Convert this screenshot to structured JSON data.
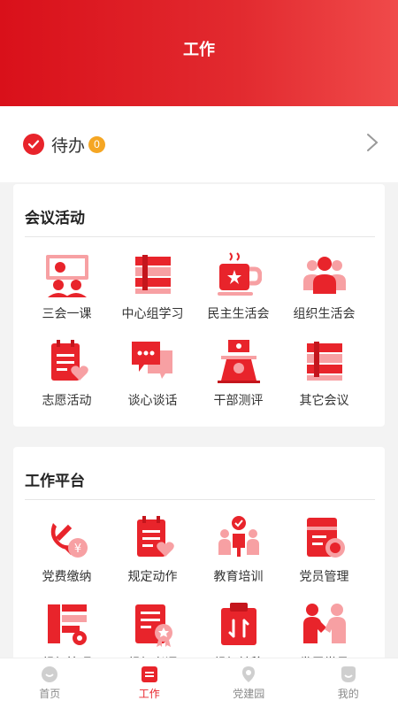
{
  "header": {
    "title": "工作"
  },
  "todo": {
    "label": "待办",
    "count": "0"
  },
  "meeting": {
    "title": "会议活动",
    "items": [
      {
        "label": "三会一课",
        "icon": "classroom-icon"
      },
      {
        "label": "中心组学习",
        "icon": "books-icon"
      },
      {
        "label": "民主生活会",
        "icon": "coffee-cup-icon"
      },
      {
        "label": "组织生活会",
        "icon": "group-people-icon"
      },
      {
        "label": "志愿活动",
        "icon": "heart-document-icon"
      },
      {
        "label": "谈心谈话",
        "icon": "chat-bubbles-icon"
      },
      {
        "label": "干部测评",
        "icon": "podium-icon"
      },
      {
        "label": "其它会议",
        "icon": "books-icon"
      }
    ]
  },
  "platform": {
    "title": "工作平台",
    "items": [
      {
        "label": "党费缴纳",
        "icon": "party-fee-icon"
      },
      {
        "label": "规定动作",
        "icon": "heart-document-icon"
      },
      {
        "label": "教育培训",
        "icon": "training-icon"
      },
      {
        "label": "党员管理",
        "icon": "member-file-icon"
      },
      {
        "label": "组织管理",
        "icon": "org-settings-icon"
      },
      {
        "label": "组织考评",
        "icon": "award-document-icon"
      },
      {
        "label": "组织转移",
        "icon": "clipboard-transfer-icon"
      },
      {
        "label": "发展党员",
        "icon": "handshake-icon"
      }
    ]
  },
  "tabbar": {
    "items": [
      {
        "label": "首页",
        "icon": "home-icon",
        "active": false
      },
      {
        "label": "工作",
        "icon": "work-icon",
        "active": true
      },
      {
        "label": "党建园",
        "icon": "location-icon",
        "active": false
      },
      {
        "label": "我的",
        "icon": "profile-icon",
        "active": false
      }
    ]
  },
  "colors": {
    "accent": "#e8242b",
    "light_accent": "#f7a0a3",
    "badge": "#f5a623"
  }
}
